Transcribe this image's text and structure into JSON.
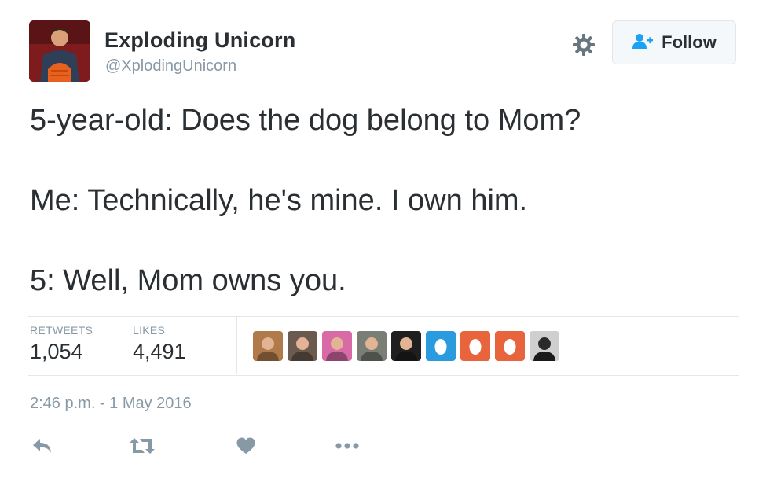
{
  "tweet": {
    "author_name": "Exploding Unicorn",
    "author_handle": "@XplodingUnicorn",
    "follow_label": "Follow",
    "text_lines": [
      "5-year-old: Does the dog belong to Mom?",
      "Me: Technically, he's mine. I own him.",
      "5: Well, Mom owns you."
    ],
    "stats": {
      "retweets_label": "RETWEETS",
      "retweets_count": "1,054",
      "likes_label": "LIKES",
      "likes_count": "4,491"
    },
    "timestamp": "2:46 p.m. - 1 May 2016"
  },
  "likers": [
    {
      "kind": "photo",
      "color": "#b07a4a"
    },
    {
      "kind": "photo",
      "color": "#6b5a4e"
    },
    {
      "kind": "photo",
      "color": "#d86aa6"
    },
    {
      "kind": "photo",
      "color": "#7a7f76"
    },
    {
      "kind": "photo",
      "color": "#1f1f1f"
    },
    {
      "kind": "egg",
      "color": "#2b9be0"
    },
    {
      "kind": "egg",
      "color": "#e8643c"
    },
    {
      "kind": "egg",
      "color": "#e8643c"
    },
    {
      "kind": "photo",
      "color": "#cfcfcf"
    }
  ],
  "icons": {
    "settings": "gear-icon",
    "follow": "add-person-icon",
    "reply": "reply-icon",
    "retweet": "retweet-icon",
    "like": "heart-icon",
    "more": "more-dots-icon"
  },
  "colors": {
    "text": "#292f33",
    "muted": "#8899a6",
    "border": "#e1e8ed",
    "follow_icon": "#1da1f2"
  }
}
